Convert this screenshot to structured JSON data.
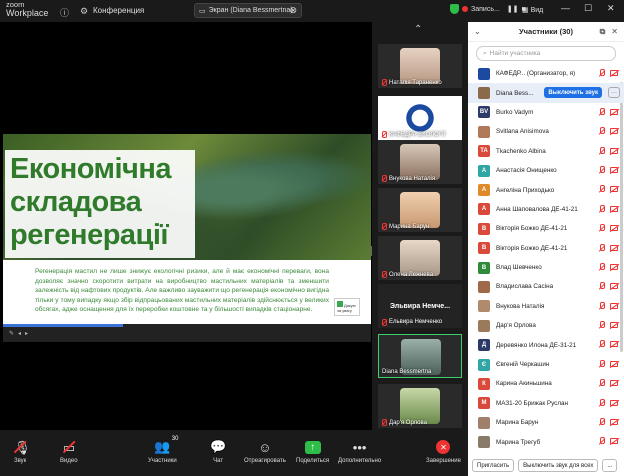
{
  "topbar": {
    "logo_line1": "zoom",
    "logo_line2": "Workplace",
    "conference_label": "Конференция",
    "screen_share_label": "Экран (Diana Bessmertna)",
    "recording_label": "Запись...",
    "view_label": "Вид"
  },
  "slide": {
    "title_lines": [
      "Економічна",
      "складова",
      "регенерації"
    ],
    "body": "Регенерація мастил не лише знижує екологічні ризики, але й має економічні переваги, вона дозволяє значно скоротити витрати на виробництво мастильних матеріалів та зменшити залежність від нафтових продуктів. Але важливо зауважити що регенерація економічно вигідна тільки у тому випадку якщо збір відпрацьованих мастильних матеріалів здійснюється у великих обсягах, адже оснащення для їх переробки коштовне та у більшості випадків стаціонарне.",
    "logo_text": "Дякую за увагу"
  },
  "filmstrip": {
    "tiles": [
      {
        "name": "Наталія Тараненко"
      },
      {
        "name": "КАФЕДРА ЕКОЛОГІЇ"
      },
      {
        "name": "Внукова Наталія"
      },
      {
        "name": "Марина Барун"
      },
      {
        "name": "Олена Лежнева"
      },
      {
        "name": "Ельвира Немченко"
      },
      {
        "name": "Diana Bessmertna"
      },
      {
        "name": "Дар'я Орлова"
      }
    ],
    "label_tile": "Эльвира Немче..."
  },
  "panel": {
    "title": "Участники (30)",
    "search_placeholder": "Найти участника",
    "mute_button": "Выключить звук",
    "participants": [
      {
        "name": "КАФЕДР... (Организатор, я)",
        "initial": "",
        "color": "#1b4aa0"
      },
      {
        "name": "Diana Bess...",
        "initial": "",
        "color": "#8a6a4a"
      },
      {
        "name": "Burko Vadym",
        "initial": "BV",
        "color": "#2b3a66"
      },
      {
        "name": "Svitlana Anisimova",
        "initial": "",
        "color": "#b07a5a"
      },
      {
        "name": "Tkachenko Albina",
        "initial": "TA",
        "color": "#d94a3a"
      },
      {
        "name": "Анастасія Онищенко",
        "initial": "А",
        "color": "#2fa5a5"
      },
      {
        "name": "Ангеліна Приходько",
        "initial": "А",
        "color": "#e08a2a"
      },
      {
        "name": "Анна Шаповалова ДЕ-41-21",
        "initial": "А",
        "color": "#d94a3a"
      },
      {
        "name": "Вікторія Божко ДЕ-41-21",
        "initial": "В",
        "color": "#d94a3a"
      },
      {
        "name": "Вікторія Божко ДЕ-41-21",
        "initial": "В",
        "color": "#d94a3a"
      },
      {
        "name": "Влад Шевченко",
        "initial": "В",
        "color": "#2f8a3a"
      },
      {
        "name": "Владислава Сасіна",
        "initial": "",
        "color": "#a06a4a"
      },
      {
        "name": "Внукова Наталія",
        "initial": "",
        "color": "#b08a6a"
      },
      {
        "name": "Дар'я Орлова",
        "initial": "",
        "color": "#9a7a5a"
      },
      {
        "name": "Деревянко Илона ДЕ-31-21",
        "initial": "Д",
        "color": "#2b3a66"
      },
      {
        "name": "Євгеній Черкашин",
        "initial": "Є",
        "color": "#2fa5a5"
      },
      {
        "name": "Карина Акиньшина",
        "initial": "К",
        "color": "#d94a3a"
      },
      {
        "name": "МАЗ1-20 Брижак Руслан",
        "initial": "М",
        "color": "#d94a3a"
      },
      {
        "name": "Марина Барун",
        "initial": "",
        "color": "#a0806a"
      },
      {
        "name": "Марина Трегуб",
        "initial": "",
        "color": "#8a7a6a"
      }
    ],
    "invite_button": "Пригласить",
    "mute_all_button": "Выключить звук для всех",
    "more_button": "..."
  },
  "bottombar": {
    "items": [
      {
        "label": "Звук"
      },
      {
        "label": "Видео"
      },
      {
        "label": "Участники"
      },
      {
        "label": "Чат"
      },
      {
        "label": "Отреагировать"
      },
      {
        "label": "Поделиться"
      },
      {
        "label": "Дополнительно"
      },
      {
        "label": "Завершение"
      }
    ],
    "participants_count": "30"
  }
}
